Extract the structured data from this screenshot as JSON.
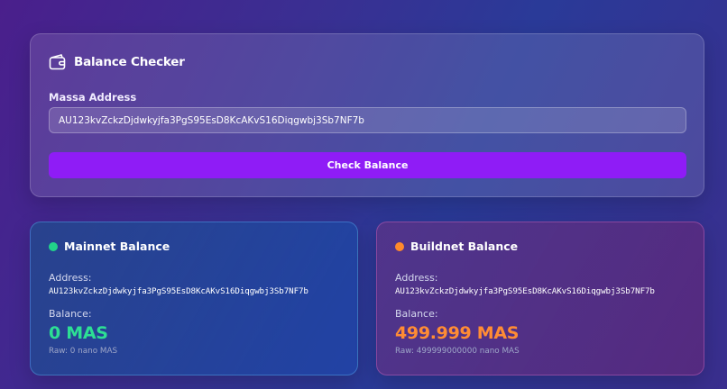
{
  "checker": {
    "title": "Balance Checker",
    "field_label": "Massa Address",
    "address_value": "AU123kvZckzDjdwkyjfa3PgS95EsD8KcAKvS16Diqgwbj3Sb7NF7b",
    "button_label": "Check Balance"
  },
  "mainnet": {
    "title": "Mainnet Balance",
    "address_label": "Address:",
    "address": "AU123kvZckzDjdwkyjfa3PgS95EsD8KcAKvS16Diqgwbj3Sb7NF7b",
    "balance_label": "Balance:",
    "balance": "0 MAS",
    "raw": "Raw: 0 nano MAS",
    "status_color": "#22d48a"
  },
  "buildnet": {
    "title": "Buildnet Balance",
    "address_label": "Address:",
    "address": "AU123kvZckzDjdwkyjfa3PgS95EsD8KcAKvS16Diqgwbj3Sb7NF7b",
    "balance_label": "Balance:",
    "balance": "499.999 MAS",
    "raw": "Raw: 499999000000 nano MAS",
    "status_color": "#ff8a2b"
  },
  "icons": {
    "checker_icon": "wallet-icon",
    "mainnet_icon": "status-dot",
    "buildnet_icon": "status-dot"
  },
  "colors": {
    "button_accent": "#8f1cf6",
    "mainnet_balance": "#2ddf94",
    "buildnet_balance": "#ff8c34"
  }
}
